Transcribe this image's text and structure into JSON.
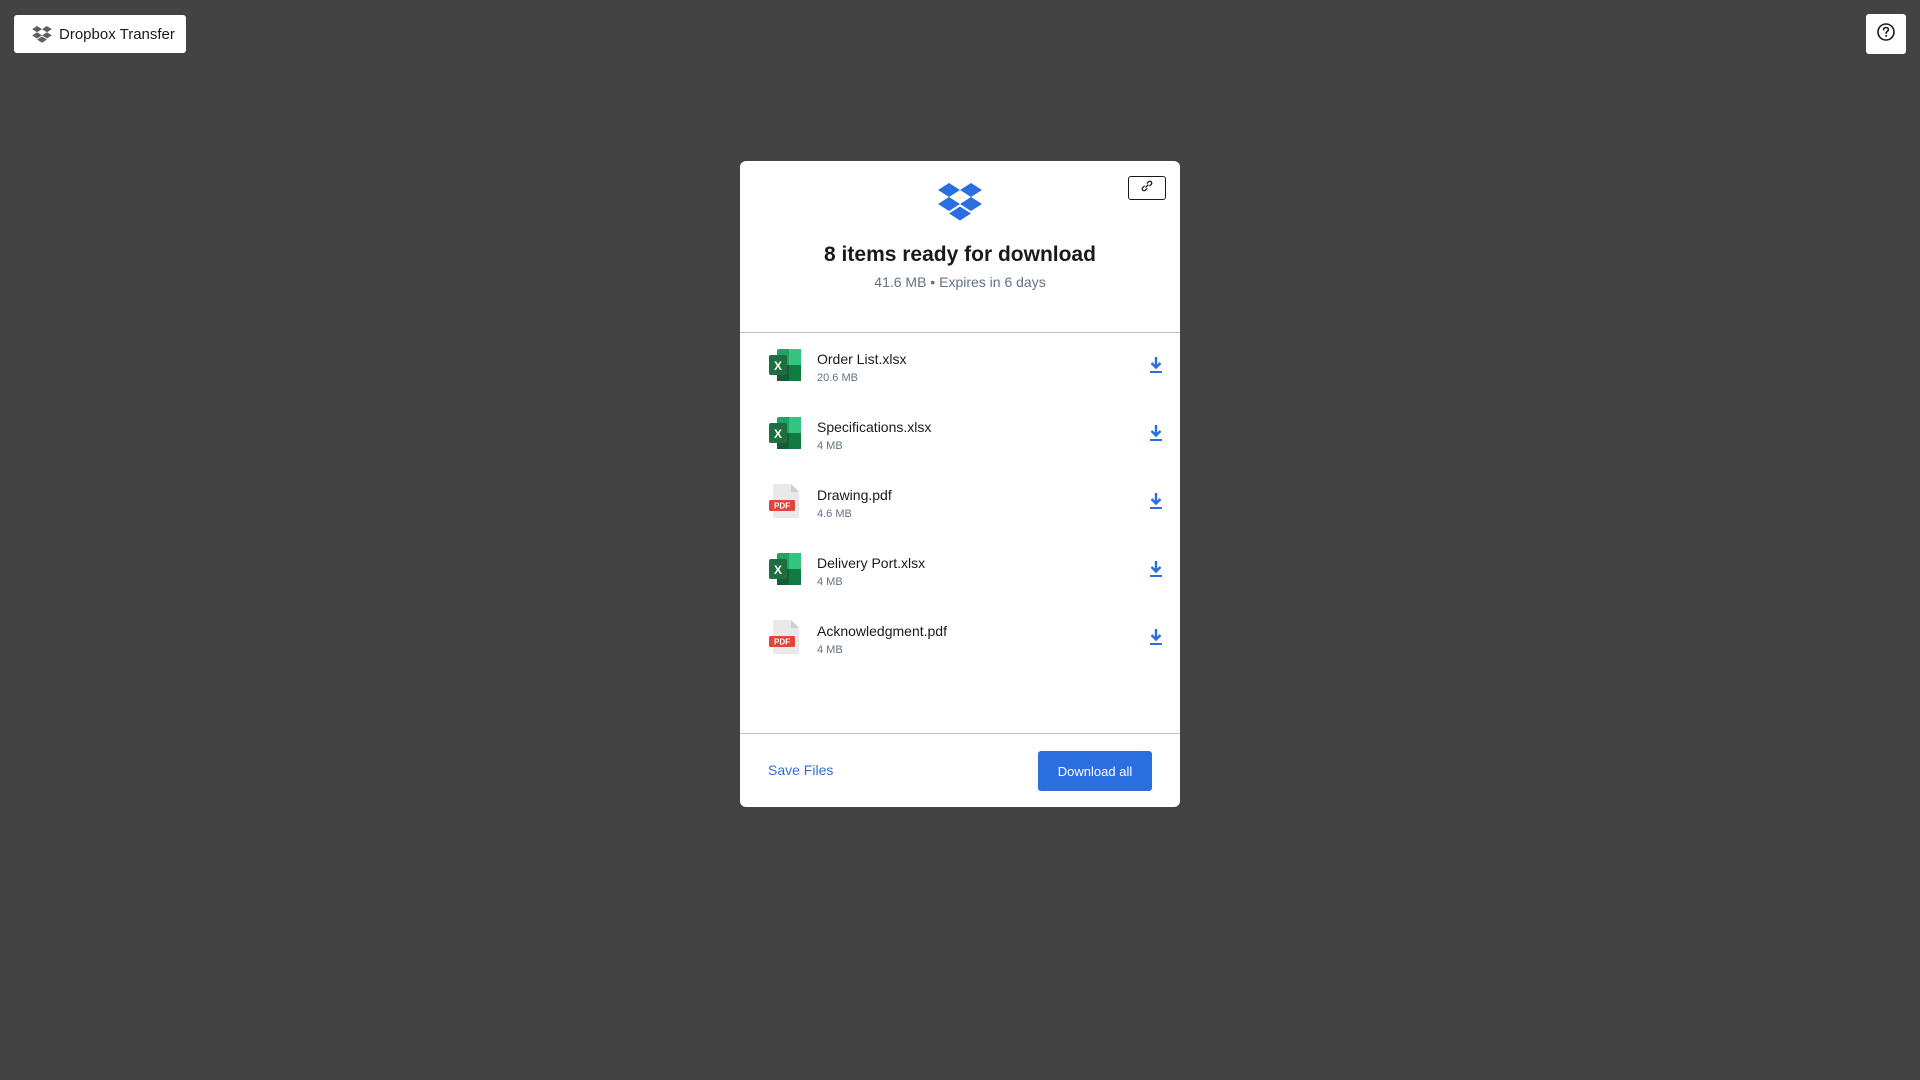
{
  "topbar": {
    "brand_label": "Dropbox Transfer",
    "brand_icon": "dropbox-logo-icon",
    "help_icon": "help-circle-icon"
  },
  "card": {
    "copy_link_icon": "link-icon",
    "title": "8 items ready for download",
    "subtitle": "41.6 MB • Expires in 6 days",
    "files": [
      {
        "name": "Order List.xlsx",
        "size": "20.6 MB",
        "type": "xlsx"
      },
      {
        "name": "Specifications.xlsx",
        "size": "4 MB",
        "type": "xlsx"
      },
      {
        "name": "Drawing.pdf",
        "size": "4.6 MB",
        "type": "pdf"
      },
      {
        "name": "Delivery Port.xlsx",
        "size": "4 MB",
        "type": "xlsx"
      },
      {
        "name": "Acknowledgment.pdf",
        "size": "4 MB",
        "type": "pdf"
      }
    ],
    "save_files_label": "Save Files",
    "download_all_label": "Download all"
  },
  "colors": {
    "background": "#434343",
    "accent": "#2a6ee0",
    "link": "#2f6fdb",
    "excel_green": "#1f7a45",
    "pdf_red": "#e2443a"
  }
}
